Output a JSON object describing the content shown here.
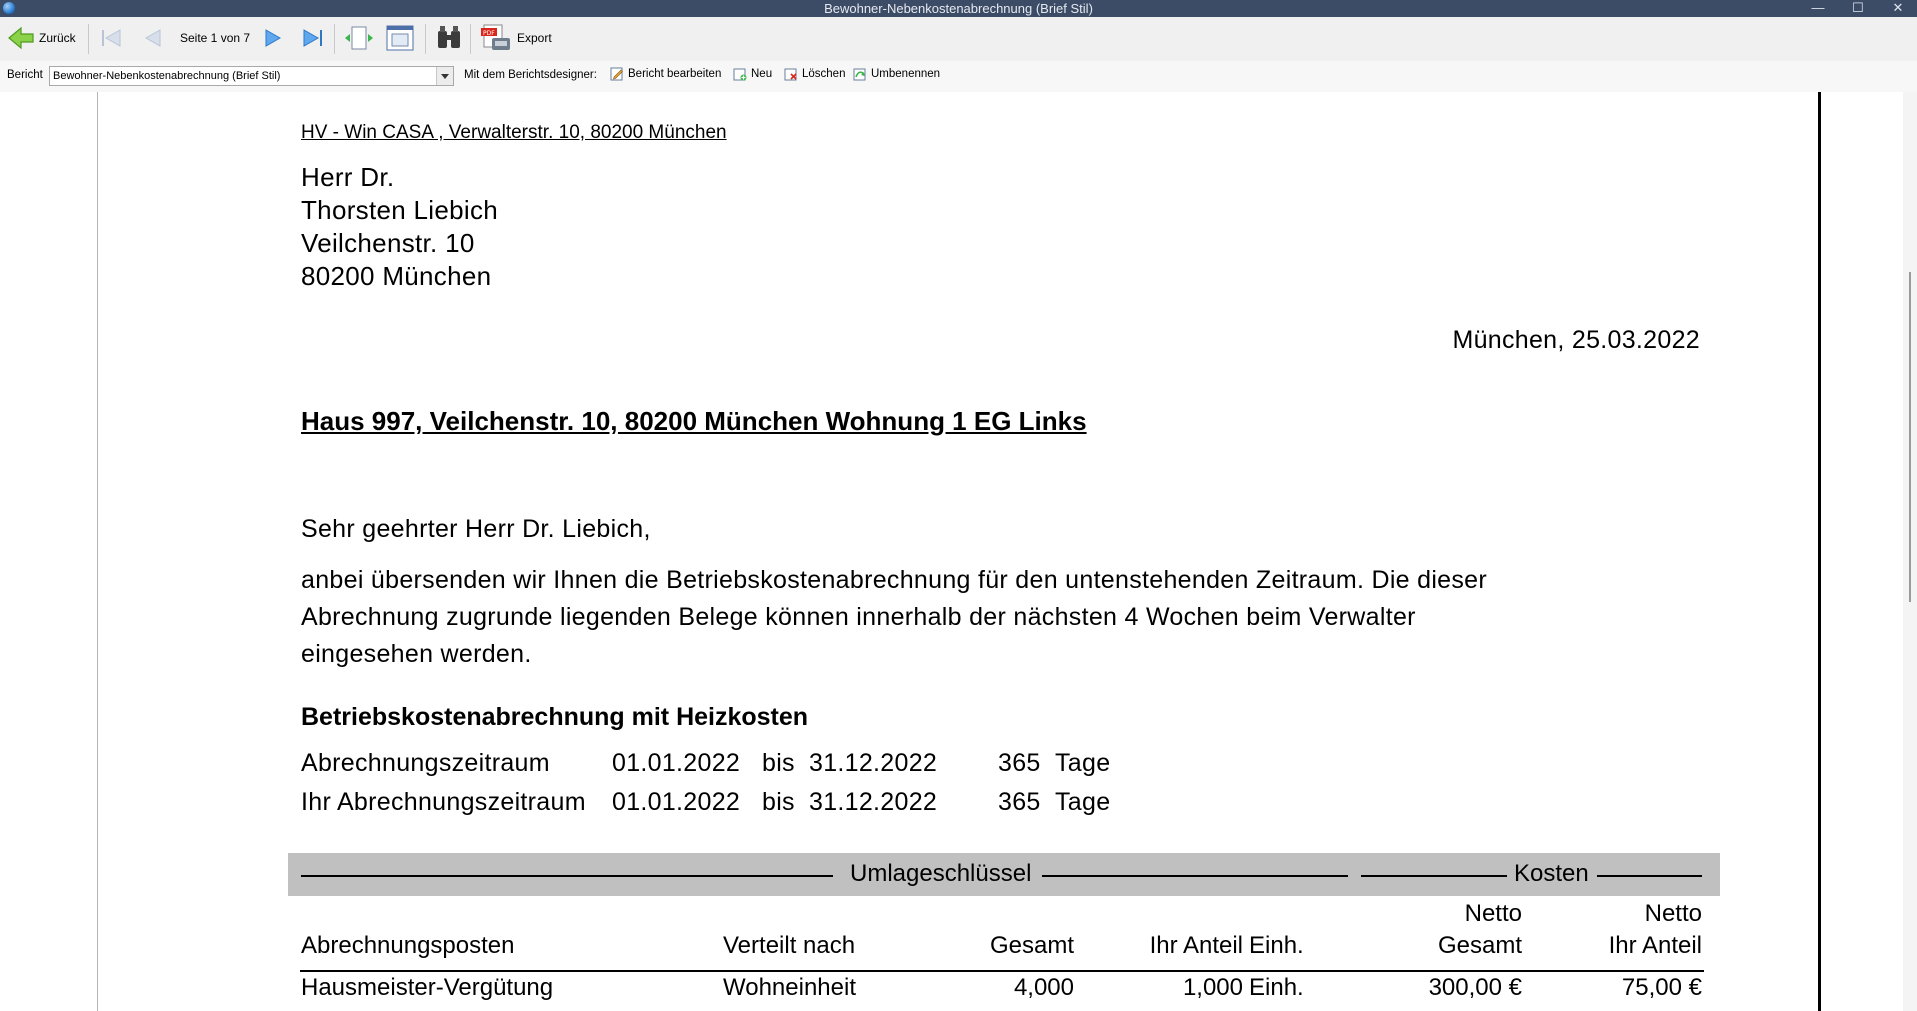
{
  "window": {
    "title": "Bewohner-Nebenkostenabrechnung (Brief Stil)",
    "minimize_glyph": "—",
    "maximize_glyph": "☐",
    "close_glyph": "✕"
  },
  "toolbar": {
    "back_label": "Zurück",
    "page_info": "Seite 1 von 7",
    "export_label": "Export"
  },
  "reportbar": {
    "report_label": "Bericht",
    "report_value": "Bewohner-Nebenkostenabrechnung (Brief Stil)",
    "designer_label": "Mit dem Berichtsdesigner:",
    "edit_label": "Bericht bearbeiten",
    "new_label": "Neu",
    "delete_label": "Löschen",
    "rename_label": "Umbenennen"
  },
  "letter": {
    "sender_line": "HV - Win CASA , Verwalterstr. 10, 80200 München",
    "recipient": [
      "Herr Dr.",
      "Thorsten Liebich",
      "Veilchenstr. 10",
      "80200 München"
    ],
    "date_line": "München, 25.03.2022",
    "subject": "Haus 997, Veilchenstr. 10, 80200 München  Wohnung 1 EG Links",
    "salutation": "Sehr geehrter Herr Dr. Liebich,",
    "body": [
      "anbei übersenden wir Ihnen die Betriebskostenabrechnung für den untenstehenden Zeitraum. Die dieser",
      "Abrechnung zugrunde liegenden Belege können innerhalb der nächsten 4 Wochen beim Verwalter",
      "eingesehen werden."
    ],
    "section_heading": "Betriebskostenabrechnung mit Heizkosten",
    "periods": [
      {
        "label": "Abrechnungszeitraum",
        "from": "01.01.2022",
        "bis": "bis",
        "to": "31.12.2022",
        "days": "365",
        "unit": "Tage"
      },
      {
        "label": "Ihr Abrechnungszeitraum",
        "from": "01.01.2022",
        "bis": "bis",
        "to": "31.12.2022",
        "days": "365",
        "unit": "Tage"
      }
    ],
    "table": {
      "group_key": "Umlageschlüssel",
      "group_costs": "Kosten",
      "netto1": "Netto",
      "netto2": "Netto",
      "headers": {
        "posten": "Abrechnungsposten",
        "verteilt": "Verteilt nach",
        "gesamt": "Gesamt",
        "anteil": "Ihr Anteil",
        "einh": "Einh.",
        "netto_gesamt": "Gesamt",
        "netto_anteil": "Ihr Anteil"
      },
      "rows": [
        {
          "posten": "Hausmeister-Vergütung",
          "verteilt": "Wohneinheit",
          "gesamt": "4,000",
          "anteil": "1,000",
          "einh": "Einh.",
          "netto_gesamt": "300,00 €",
          "netto_anteil": "75,00 €"
        }
      ]
    }
  }
}
